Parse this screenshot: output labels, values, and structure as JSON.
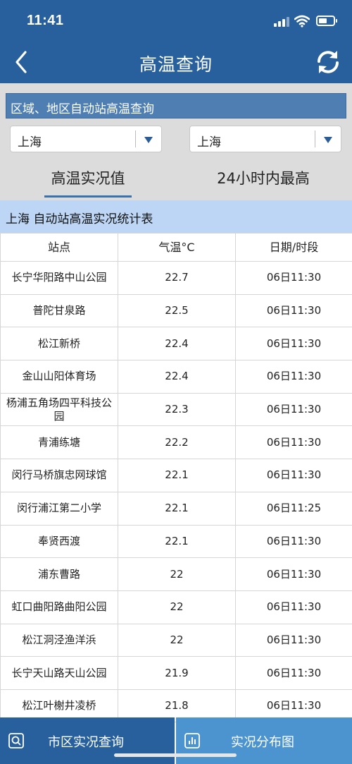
{
  "status_bar": {
    "time": "11:41",
    "icons": [
      "signal-icon",
      "wifi-icon",
      "battery-icon"
    ]
  },
  "nav": {
    "title": "高温查询",
    "back_icon": "chevron-left-icon",
    "refresh_icon": "refresh-icon"
  },
  "query": {
    "label": "区域、地区自动站高温查询",
    "region_select": "上海",
    "area_select": "上海"
  },
  "tabs": [
    {
      "label": "高温实况值",
      "active": true
    },
    {
      "label": "24小时内最高",
      "active": false
    }
  ],
  "table": {
    "title": "上海 自动站高温实况统计表",
    "headers": [
      "站点",
      "气温°C",
      "日期/时段"
    ],
    "rows": [
      {
        "station": "长宁华阳路中山公园",
        "temp": "22.7",
        "time": "06日11:30"
      },
      {
        "station": "普陀甘泉路",
        "temp": "22.5",
        "time": "06日11:30"
      },
      {
        "station": "松江新桥",
        "temp": "22.4",
        "time": "06日11:30"
      },
      {
        "station": "金山山阳体育场",
        "temp": "22.4",
        "time": "06日11:30"
      },
      {
        "station": "杨浦五角场四平科技公园",
        "temp": "22.3",
        "time": "06日11:30"
      },
      {
        "station": "青浦练塘",
        "temp": "22.2",
        "time": "06日11:30"
      },
      {
        "station": "闵行马桥旗忠网球馆",
        "temp": "22.1",
        "time": "06日11:30"
      },
      {
        "station": "闵行浦江第二小学",
        "temp": "22.1",
        "time": "06日11:25"
      },
      {
        "station": "奉贤西渡",
        "temp": "22.1",
        "time": "06日11:30"
      },
      {
        "station": "浦东曹路",
        "temp": "22",
        "time": "06日11:30"
      },
      {
        "station": "虹口曲阳路曲阳公园",
        "temp": "22",
        "time": "06日11:30"
      },
      {
        "station": "松江洞泾渔洋浜",
        "temp": "22",
        "time": "06日11:30"
      },
      {
        "station": "长宁天山路天山公园",
        "temp": "21.9",
        "time": "06日11:30"
      },
      {
        "station": "松江叶榭井凌桥",
        "temp": "21.8",
        "time": "06日11:30"
      }
    ]
  },
  "bottom": {
    "left_label": "市区实况查询",
    "left_icon": "search-icon",
    "right_label": "实况分布图",
    "right_icon": "bar-chart-icon"
  },
  "colors": {
    "header": "#27609c",
    "query_label": "#4f7fb2",
    "table_title": "#bdd6f5",
    "bottom_right": "#4b94cf"
  }
}
